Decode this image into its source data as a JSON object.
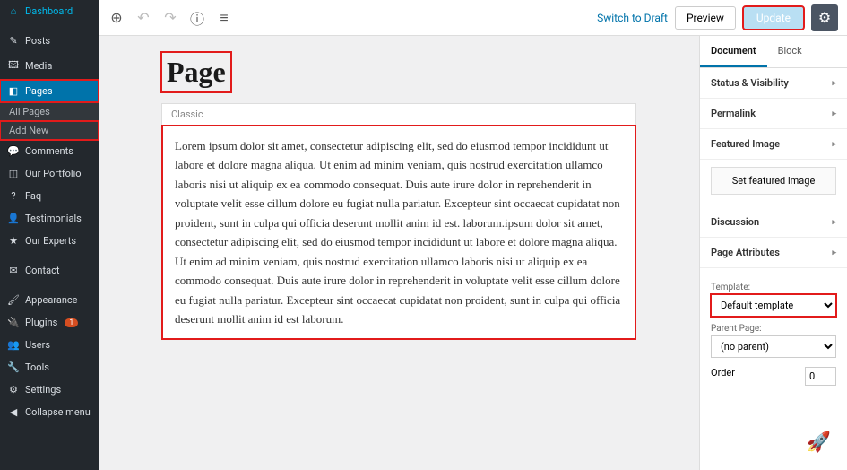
{
  "sidebar": {
    "items": [
      {
        "icon": "⌂",
        "label": "Dashboard"
      },
      {
        "icon": "✎",
        "label": "Posts"
      },
      {
        "icon": "🖾",
        "label": "Media"
      },
      {
        "icon": "◧",
        "label": "Pages",
        "active": true
      },
      {
        "icon": "💬",
        "label": "Comments"
      },
      {
        "icon": "◫",
        "label": "Our Portfolio"
      },
      {
        "icon": "?",
        "label": "Faq"
      },
      {
        "icon": "👤",
        "label": "Testimonials"
      },
      {
        "icon": "★",
        "label": "Our Experts"
      },
      {
        "icon": "✉",
        "label": "Contact"
      },
      {
        "icon": "🖌",
        "label": "Appearance"
      },
      {
        "icon": "🔌",
        "label": "Plugins",
        "badge": "1"
      },
      {
        "icon": "👥",
        "label": "Users"
      },
      {
        "icon": "🔧",
        "label": "Tools"
      },
      {
        "icon": "⚙",
        "label": "Settings"
      },
      {
        "icon": "◀",
        "label": "Collapse menu"
      }
    ],
    "subs": [
      "All Pages",
      "Add New"
    ]
  },
  "topbar": {
    "switch": "Switch to Draft",
    "preview": "Preview",
    "update": "Update"
  },
  "editor": {
    "title": "Page",
    "block_label": "Classic",
    "content": "Lorem ipsum dolor sit amet, consectetur adipiscing elit, sed do eiusmod tempor incididunt ut labore et dolore magna aliqua. Ut enim ad minim veniam, quis nostrud exercitation ullamco laboris nisi ut aliquip ex ea commodo consequat. Duis aute irure dolor in reprehenderit in voluptate velit esse cillum dolore eu fugiat nulla pariatur. Excepteur sint occaecat cupidatat non proident, sunt in culpa qui officia deserunt mollit anim id est. laborum.ipsum dolor sit amet, consectetur adipiscing elit, sed do eiusmod tempor incididunt ut labore et dolore magna aliqua. Ut enim ad minim veniam, quis nostrud exercitation ullamco laboris nisi ut aliquip ex ea commodo consequat. Duis aute irure dolor in reprehenderit in voluptate velit esse cillum dolore eu fugiat nulla pariatur. Excepteur sint occaecat cupidatat non proident, sunt in culpa qui officia deserunt mollit anim id est laborum."
  },
  "panel": {
    "tabs": [
      "Document",
      "Block"
    ],
    "sections": {
      "status": "Status & Visibility",
      "permalink": "Permalink",
      "featured": "Featured Image",
      "featured_btn": "Set featured image",
      "discussion": "Discussion",
      "attrs": "Page Attributes",
      "template_lbl": "Template:",
      "template_val": "Default template",
      "parent_lbl": "Parent Page:",
      "parent_val": "(no parent)",
      "order_lbl": "Order",
      "order_val": "0"
    }
  }
}
